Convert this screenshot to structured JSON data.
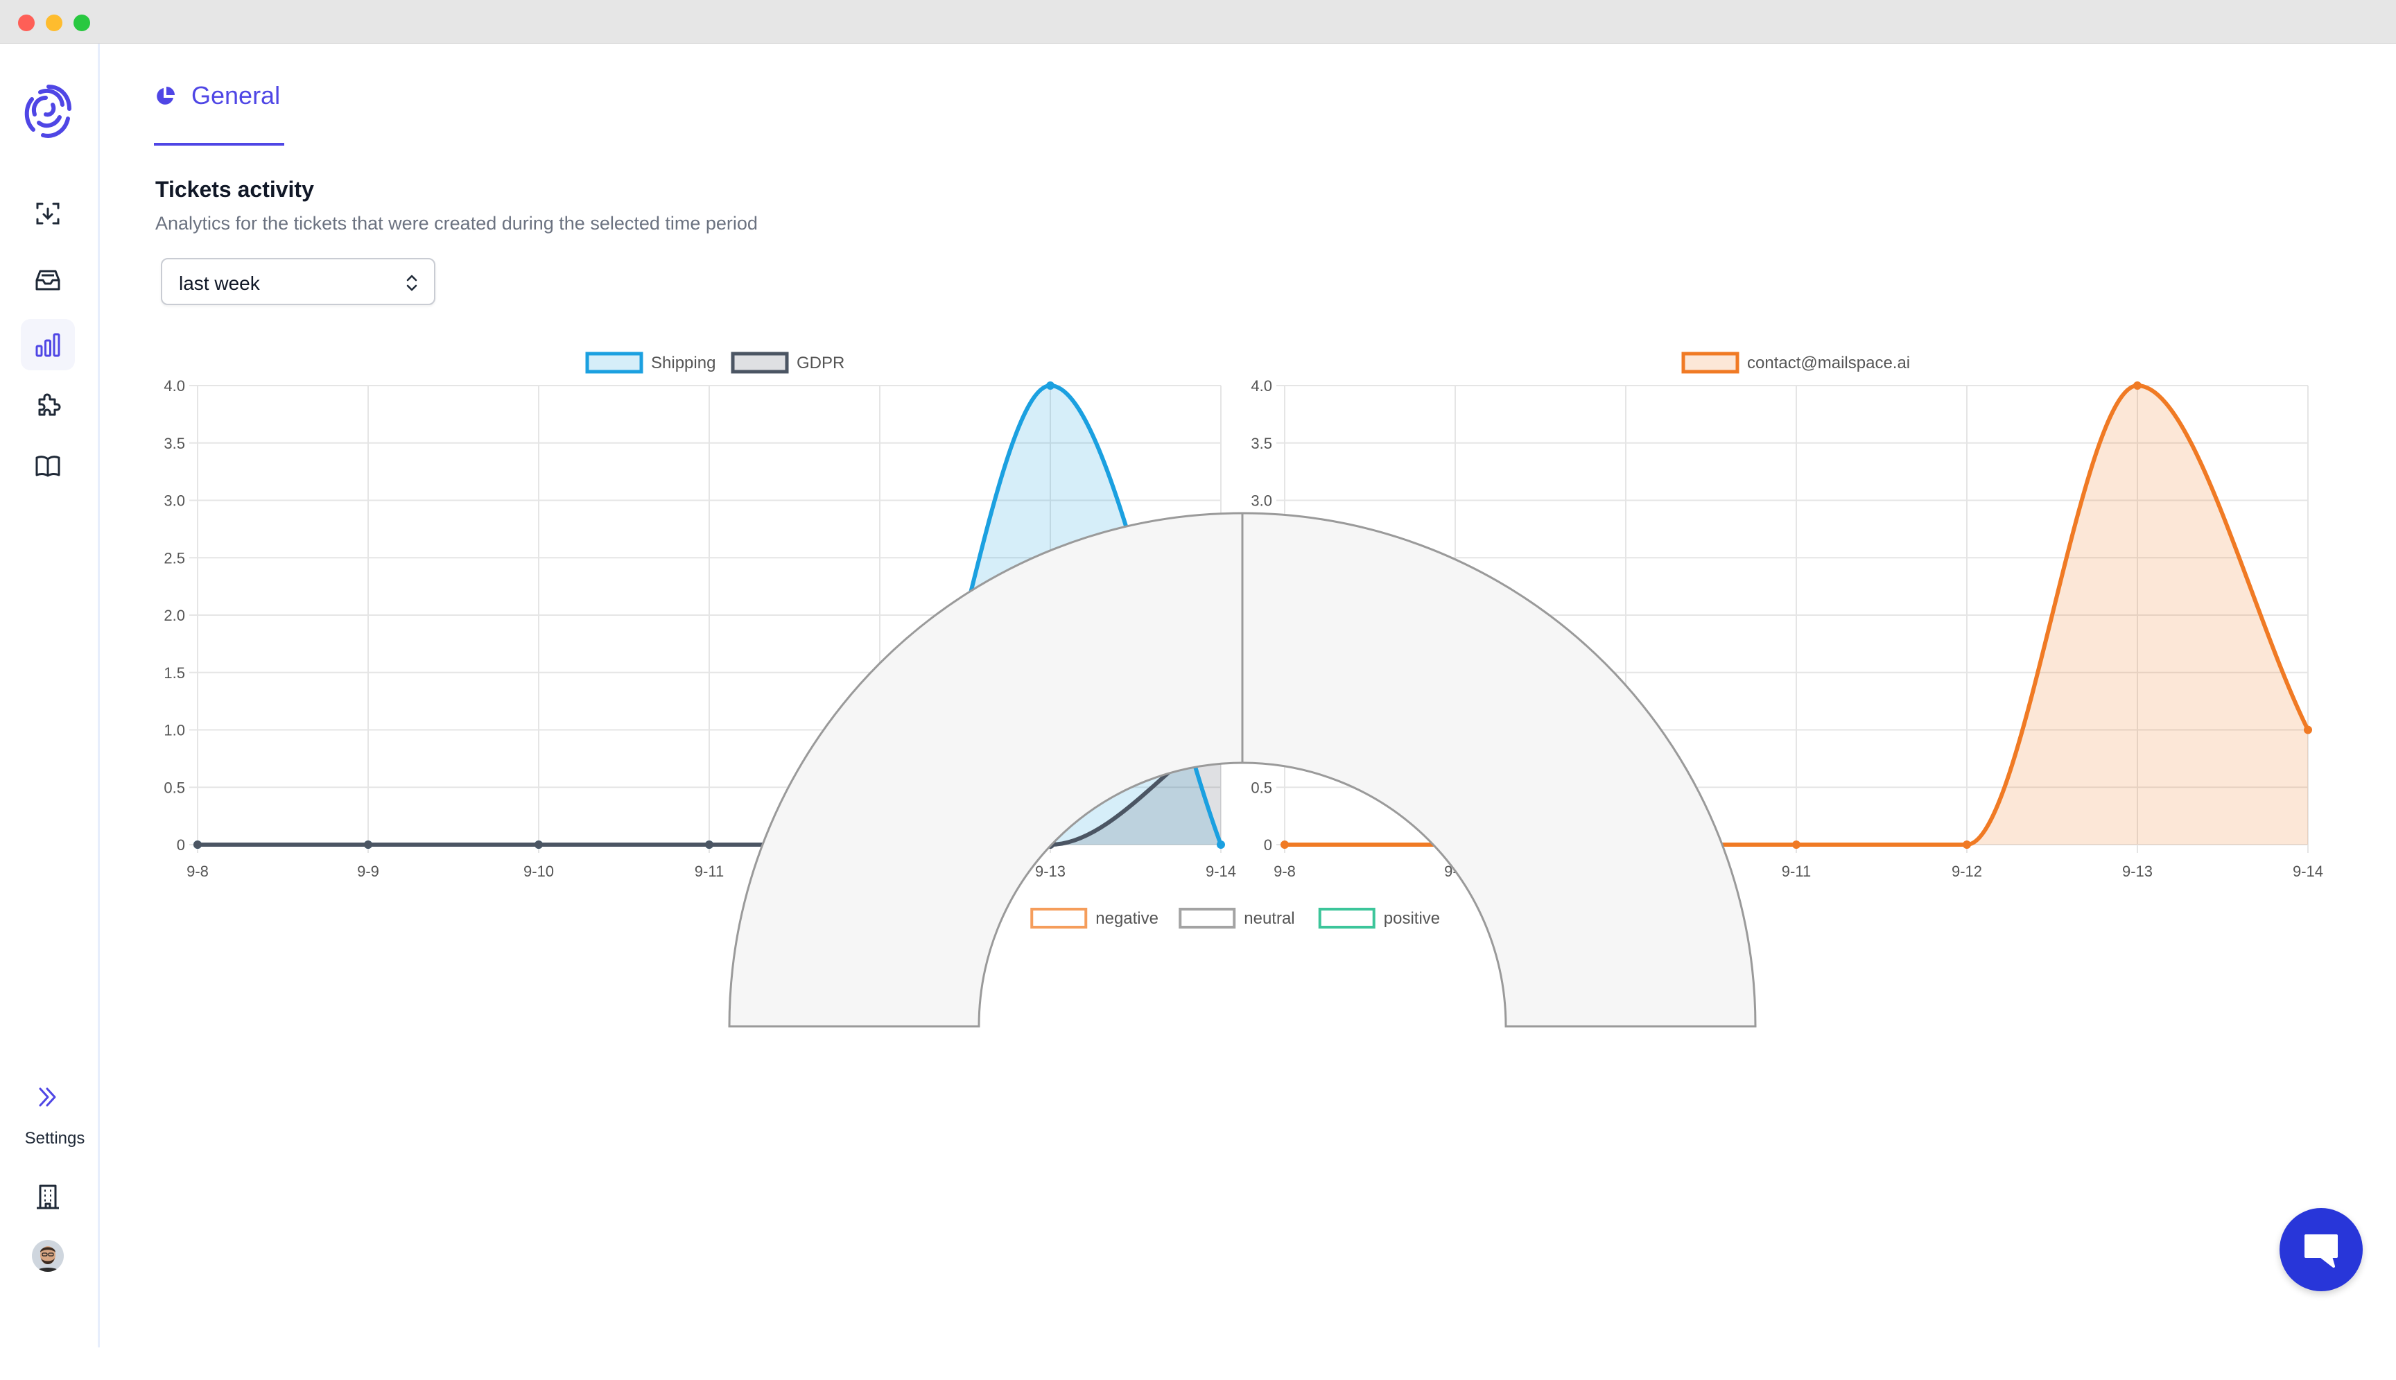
{
  "sidebar": {
    "settings_label": "Settings",
    "items": [
      {
        "icon": "focus-icon",
        "active": false
      },
      {
        "icon": "inbox-icon",
        "active": false
      },
      {
        "icon": "bar-chart-icon",
        "active": true
      },
      {
        "icon": "puzzle-icon",
        "active": false
      },
      {
        "icon": "book-icon",
        "active": false
      }
    ],
    "bottom_items": [
      "double-chevron-right-icon",
      "building-icon",
      "avatar",
      "logout-icon"
    ]
  },
  "tabs": [
    {
      "label": "General",
      "icon": "pie-chart-icon",
      "active": true
    }
  ],
  "section": {
    "title": "Tickets activity",
    "subtitle": "Analytics for the tickets that were created during the selected time period"
  },
  "period_select": {
    "value": "last week"
  },
  "colors": {
    "accent": "#4f46e5",
    "shipping": "#1ba0e0",
    "gdpr": "#4b5563",
    "mailbox": "#f07a24",
    "negative": "#f59d5b",
    "neutral": "#a3a3a3",
    "positive": "#3cc59a",
    "chat": "#2836d9"
  },
  "chart_data": [
    {
      "type": "line",
      "x": [
        "9-8",
        "9-9",
        "9-10",
        "9-11",
        "9-12",
        "9-13",
        "9-14"
      ],
      "ylim": [
        0,
        4
      ],
      "yticks": [
        "0",
        "0.5",
        "1.0",
        "1.5",
        "2.0",
        "2.5",
        "3.0",
        "3.5",
        "4.0"
      ],
      "grid": true,
      "legend_position": "top-center",
      "series": [
        {
          "name": "Shipping",
          "values": [
            0,
            0,
            0,
            0,
            0,
            4,
            0
          ],
          "fill": true
        },
        {
          "name": "GDPR",
          "values": [
            0,
            0,
            0,
            0,
            0,
            0,
            1
          ],
          "fill": true
        }
      ]
    },
    {
      "type": "line",
      "x": [
        "9-8",
        "9-9",
        "9-10",
        "9-11",
        "9-12",
        "9-13",
        "9-14"
      ],
      "ylim": [
        0,
        4
      ],
      "yticks": [
        "0",
        "0.5",
        "1.0",
        "1.5",
        "2.0",
        "2.5",
        "3.0",
        "3.5",
        "4.0"
      ],
      "grid": true,
      "legend_position": "top-center",
      "series": [
        {
          "name": "contact@mailspace.ai",
          "values": [
            0,
            0,
            0,
            0,
            0,
            4,
            1
          ],
          "fill": true
        }
      ]
    },
    {
      "type": "pie",
      "legend_position": "top-center",
      "categories": [
        "negative",
        "neutral",
        "positive"
      ],
      "values": [
        0,
        0,
        0
      ]
    }
  ]
}
